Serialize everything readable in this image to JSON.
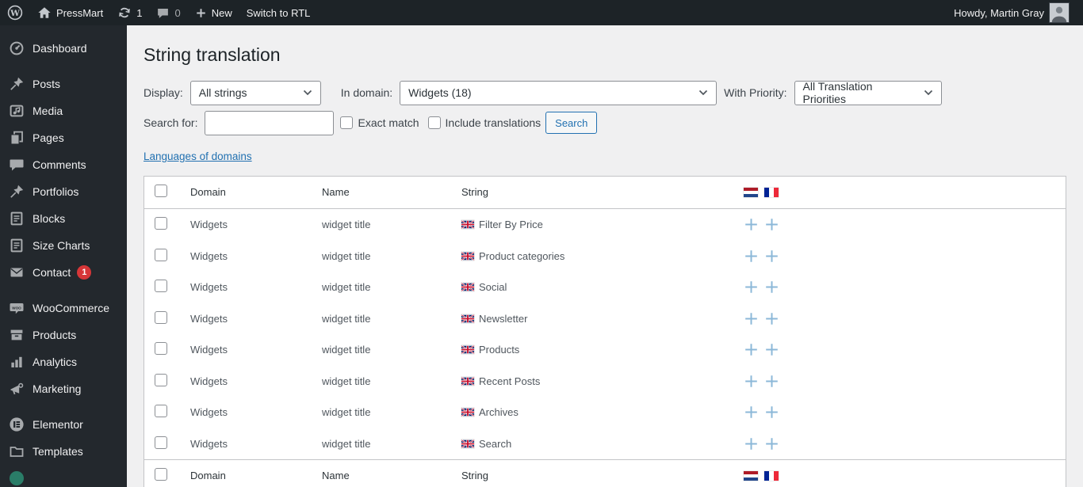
{
  "admin_bar": {
    "site_name": "PressMart",
    "updates_count": "1",
    "comments_count": "0",
    "new_label": "New",
    "rtl_toggle": "Switch to RTL",
    "howdy": "Howdy, Martin Gray"
  },
  "sidebar": {
    "groups": [
      [
        {
          "label": "Dashboard",
          "icon": "dashboard-icon"
        }
      ],
      [
        {
          "label": "Posts",
          "icon": "pushpin-icon"
        },
        {
          "label": "Media",
          "icon": "media-icon"
        },
        {
          "label": "Pages",
          "icon": "pages-icon"
        },
        {
          "label": "Comments",
          "icon": "comment-icon"
        },
        {
          "label": "Portfolios",
          "icon": "pushpin-icon"
        },
        {
          "label": "Blocks",
          "icon": "document-icon"
        },
        {
          "label": "Size Charts",
          "icon": "document-icon"
        },
        {
          "label": "Contact",
          "icon": "envelope-icon",
          "badge": "1"
        }
      ],
      [
        {
          "label": "WooCommerce",
          "icon": "woocommerce-icon"
        },
        {
          "label": "Products",
          "icon": "box-icon"
        },
        {
          "label": "Analytics",
          "icon": "bar-chart-icon"
        },
        {
          "label": "Marketing",
          "icon": "megaphone-icon"
        }
      ],
      [
        {
          "label": "Elementor",
          "icon": "elementor-icon"
        },
        {
          "label": "Templates",
          "icon": "folder-icon"
        },
        {
          "label": "",
          "icon": "teal-circle-icon"
        }
      ]
    ]
  },
  "page": {
    "title": "String translation",
    "filters": {
      "display_label": "Display:",
      "display_value": "All strings",
      "domain_label": "In domain:",
      "domain_value": "Widgets (18)",
      "priority_label": "With Priority:",
      "priority_value": "All Translation Priorities"
    },
    "search": {
      "label": "Search for:",
      "value": "",
      "exact_match_label": "Exact match",
      "include_translations_label": "Include translations",
      "button_label": "Search"
    },
    "languages_link": "Languages of domains"
  },
  "table": {
    "headers": {
      "domain": "Domain",
      "name": "Name",
      "string": "String"
    },
    "language_flags": [
      "nl-flag",
      "fr-flag"
    ],
    "rows": [
      {
        "domain": "Widgets",
        "name": "widget title",
        "string": "Filter By Price",
        "flag": "uk-flag"
      },
      {
        "domain": "Widgets",
        "name": "widget title",
        "string": "Product categories",
        "flag": "uk-flag"
      },
      {
        "domain": "Widgets",
        "name": "widget title",
        "string": "Social",
        "flag": "uk-flag"
      },
      {
        "domain": "Widgets",
        "name": "widget title",
        "string": "Newsletter",
        "flag": "uk-flag"
      },
      {
        "domain": "Widgets",
        "name": "widget title",
        "string": "Products",
        "flag": "uk-flag"
      },
      {
        "domain": "Widgets",
        "name": "widget title",
        "string": "Recent Posts",
        "flag": "uk-flag"
      },
      {
        "domain": "Widgets",
        "name": "widget title",
        "string": "Archives",
        "flag": "uk-flag"
      },
      {
        "domain": "Widgets",
        "name": "widget title",
        "string": "Search",
        "flag": "uk-flag"
      }
    ]
  },
  "colors": {
    "admin_bar_bg": "#1d2327",
    "sidebar_bg": "#23282d",
    "content_bg": "#f0f0f1",
    "link_blue": "#2271b1",
    "plus_blue": "#8cb8d8",
    "badge_red": "#d63638",
    "table_border": "#c3c4c7"
  }
}
